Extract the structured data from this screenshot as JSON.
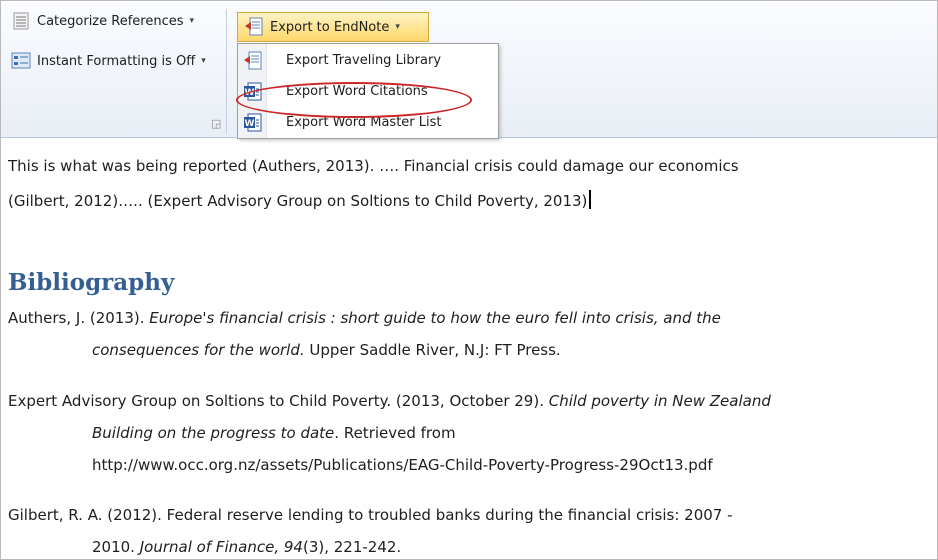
{
  "ribbon": {
    "categorize_label": "Categorize References",
    "formatting_label": "Instant Formatting is Off",
    "endnote_button_label": "Export to EndNote",
    "menu_items": [
      {
        "label": "Export Traveling Library",
        "icon": "endnote-export-icon"
      },
      {
        "label": "Export Word Citations",
        "icon": "word-doc-icon",
        "highlighted": true
      },
      {
        "label": "Export Word Master List",
        "icon": "word-doc-icon"
      }
    ],
    "highlight_color": "#cc2626"
  },
  "document": {
    "para1_line1": "This is what was being reported (Authers, 2013). …. Financial crisis could damage our economics",
    "para1_line2": "(Gilbert, 2012)….. (Expert Advisory Group on Soltions to Child Poverty, 2013)",
    "heading": "Bibliography",
    "bib": {
      "ref1_a": "Authers, J. (2013). ",
      "ref1_title_a": "Europe's financial crisis : short guide to how the euro fell into crisis, and the",
      "ref1_title_b": "consequences for the world.",
      "ref1_b": " Upper Saddle River, N.J: FT Press.",
      "ref2_a": "Expert Advisory Group on Soltions to Child Poverty. (2013, October 29). ",
      "ref2_title_a": "Child poverty in New Zealand",
      "ref2_title_b": "Building on the progress to date",
      "ref2_b": ". Retrieved from",
      "ref2_url": "http://www.occ.org.nz/assets/Publications/EAG-Child-Poverty-Progress-29Oct13.pdf",
      "ref3_a": "Gilbert, R. A. (2012). Federal reserve lending to troubled banks during the financial crisis: 2007 -",
      "ref3_b": "2010. ",
      "ref3_journal": "Journal of Finance, 94",
      "ref3_c": "(3), 221-242."
    }
  }
}
